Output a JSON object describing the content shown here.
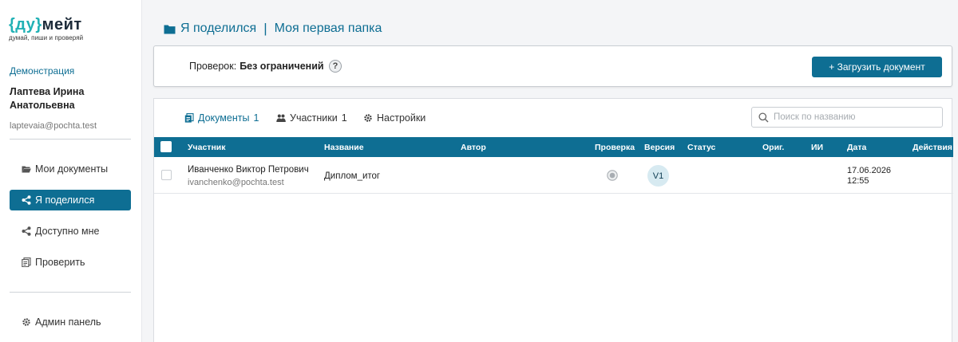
{
  "logo": {
    "brace_open": "{",
    "brand_a": "ду",
    "brace_close": "}",
    "brand_b": "мейт",
    "tagline": "думай, пиши и проверяй"
  },
  "user": {
    "org": "Демонстрация",
    "name": "Лаптева Ирина Анатольевна",
    "email": "laptevaia@pochta.test"
  },
  "nav": {
    "items": [
      {
        "label": "Мои документы",
        "icon": "folder-open-icon"
      },
      {
        "label": "Я поделился",
        "icon": "share-icon",
        "active": true
      },
      {
        "label": "Доступно мне",
        "icon": "share-icon"
      },
      {
        "label": "Проверить",
        "icon": "documents-icon"
      }
    ],
    "admin": {
      "label": "Админ панель",
      "icon": "gear-icon"
    }
  },
  "header": {
    "section": "Я поделился",
    "separator": "|",
    "folder": "Моя первая папка"
  },
  "limits": {
    "label": "Проверок:",
    "value": "Без ограничений",
    "help": "?",
    "upload_button": "+ Загрузить документ"
  },
  "tabs": [
    {
      "label": "Документы",
      "count": "1",
      "icon": "documents-icon",
      "active": true
    },
    {
      "label": "Участники",
      "count": "1",
      "icon": "users-icon"
    },
    {
      "label": "Настройки",
      "icon": "gear-icon"
    }
  ],
  "search": {
    "placeholder": "Поиск по названию"
  },
  "table": {
    "columns": {
      "participant": "Участник",
      "title": "Название",
      "author": "Автор",
      "check": "Проверка",
      "version": "Версия",
      "status": "Статус",
      "orig": "Ориг.",
      "ai": "ИИ",
      "date": "Дата",
      "actions": "Действия"
    },
    "rows": [
      {
        "participant_name": "Иванченко Виктор Петрович",
        "participant_email": "ivanchenko@pochta.test",
        "title": "Диплом_итог",
        "version": "V1",
        "date": "17.06.2026",
        "time": "12:55"
      }
    ]
  },
  "colors": {
    "accent": "#0e6e93",
    "logo_accent": "#21b1b5"
  }
}
